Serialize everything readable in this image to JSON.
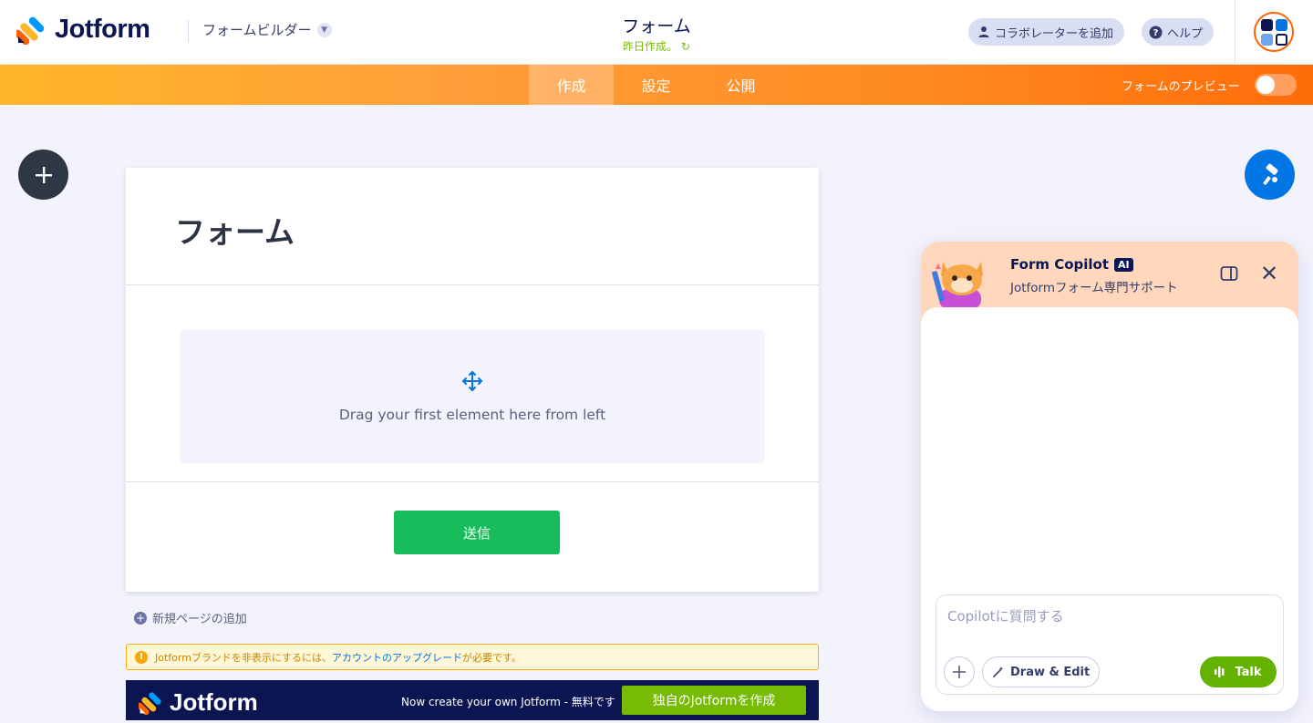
{
  "header": {
    "logo_text": "Jotform",
    "builder_label": "フォームビルダー",
    "form_title": "フォーム",
    "saved_status": "昨日作成。",
    "collab_label": "コラボレーターを追加",
    "help_label": "ヘルプ"
  },
  "nav": {
    "tabs": [
      {
        "label": "作成",
        "active": true
      },
      {
        "label": "設定",
        "active": false
      },
      {
        "label": "公開",
        "active": false
      }
    ],
    "preview_label": "フォームのプレビュー",
    "preview_on": false
  },
  "form": {
    "title": "フォーム",
    "drop_hint": "Drag your first element here from left",
    "submit_label": "送信",
    "add_page_label": "新規ページの追加"
  },
  "warning": {
    "text_before": "Jotformブランドを非表示にするには、",
    "link_text": "アカウントのアップグレード",
    "text_after": "が必要です。"
  },
  "promo": {
    "logo_text": "Jotform",
    "text": "Now create your own Jotform - 無料です",
    "button_label": "独自のJotformを作成"
  },
  "copilot": {
    "title": "Form Copilot",
    "badge": "AI",
    "subtitle": "Jotformフォーム専門サポート",
    "placeholder": "Copilotに質問する",
    "draw_label": "Draw & Edit",
    "talk_label": "Talk"
  },
  "colors": {
    "brand_orange": "#ff6100",
    "navy": "#0a1551",
    "submit_green": "#18bd5b",
    "talk_green": "#64b200",
    "paint_blue": "#0075e3"
  },
  "icons": {
    "add": "plus-icon",
    "paint": "paint-roller-icon",
    "move": "move-arrows-icon",
    "user": "user-icon",
    "help": "question-icon",
    "apps": "apps-grid-icon",
    "close": "close-icon",
    "dock": "dock-panel-icon",
    "talk": "audio-bars-icon",
    "draw": "magic-wand-icon"
  }
}
